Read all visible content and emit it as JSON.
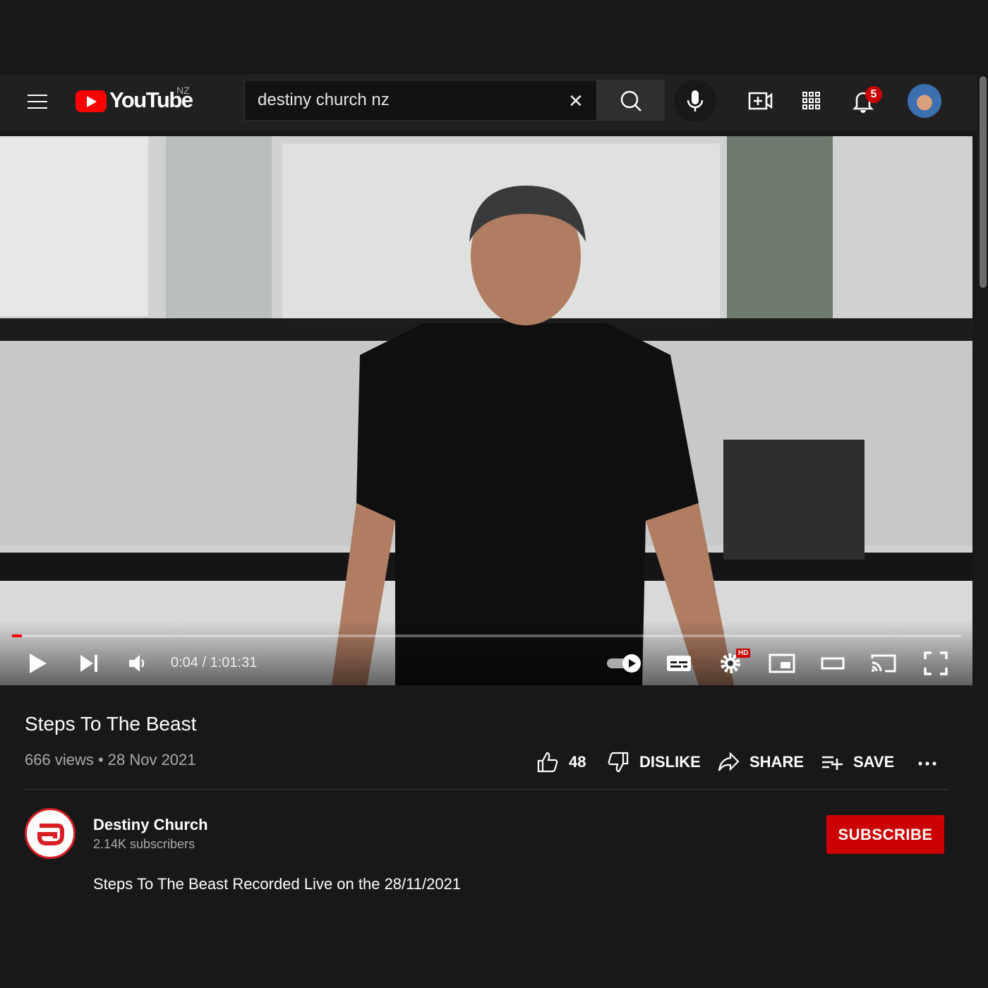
{
  "header": {
    "logo_text": "YouTube",
    "region": "NZ",
    "search_value": "destiny church nz",
    "notification_count": "5"
  },
  "player": {
    "time_current": "0:04",
    "time_total": "1:01:31",
    "time_display": "0:04 / 1:01:31",
    "progress_fraction": 0.001,
    "quality_badge": "HD"
  },
  "video": {
    "title": "Steps To The Beast",
    "views": "666 views",
    "date": "28 Nov 2021",
    "meta": "666 views • 28 Nov 2021",
    "actions": {
      "like_count": "48",
      "dislike_label": "DISLIKE",
      "share_label": "SHARE",
      "save_label": "SAVE"
    }
  },
  "channel": {
    "name": "Destiny Church",
    "subscribers": "2.14K subscribers",
    "subscribe_label": "SUBSCRIBE"
  },
  "description": "Steps To The Beast Recorded Live on the 28/11/2021",
  "colors": {
    "brand_red": "#ff0000",
    "subscribe_red": "#cc0000",
    "background": "#181818",
    "header": "#202020"
  },
  "icons": [
    "menu-icon",
    "youtube-logo",
    "clear-icon",
    "search-icon",
    "mic-icon",
    "create-video-icon",
    "apps-icon",
    "bell-icon",
    "play-icon",
    "next-icon",
    "volume-icon",
    "autoplay-toggle",
    "subtitles-icon",
    "settings-icon",
    "miniplayer-icon",
    "theater-icon",
    "cast-icon",
    "fullscreen-icon",
    "thumb-up-icon",
    "thumb-down-icon",
    "share-icon",
    "save-playlist-icon",
    "more-icon"
  ]
}
